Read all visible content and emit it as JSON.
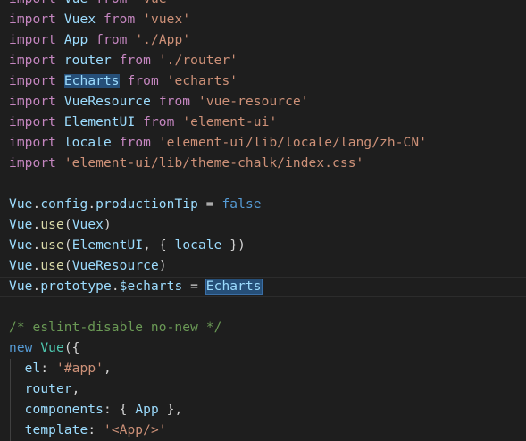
{
  "editor": {
    "lines": [
      {
        "tokens": [
          {
            "t": "import",
            "c": "kw"
          },
          {
            "t": " ",
            "c": "punc"
          },
          {
            "t": "Vue",
            "c": "id"
          },
          {
            "t": " ",
            "c": "punc"
          },
          {
            "t": "from",
            "c": "kw"
          },
          {
            "t": " ",
            "c": "punc"
          },
          {
            "t": "'vue'",
            "c": "str"
          }
        ]
      },
      {
        "tokens": [
          {
            "t": "import",
            "c": "kw"
          },
          {
            "t": " ",
            "c": "punc"
          },
          {
            "t": "Vuex",
            "c": "id"
          },
          {
            "t": " ",
            "c": "punc"
          },
          {
            "t": "from",
            "c": "kw"
          },
          {
            "t": " ",
            "c": "punc"
          },
          {
            "t": "'vuex'",
            "c": "str"
          }
        ]
      },
      {
        "tokens": [
          {
            "t": "import",
            "c": "kw"
          },
          {
            "t": " ",
            "c": "punc"
          },
          {
            "t": "App",
            "c": "id"
          },
          {
            "t": " ",
            "c": "punc"
          },
          {
            "t": "from",
            "c": "kw"
          },
          {
            "t": " ",
            "c": "punc"
          },
          {
            "t": "'./App'",
            "c": "str"
          }
        ]
      },
      {
        "tokens": [
          {
            "t": "import",
            "c": "kw"
          },
          {
            "t": " ",
            "c": "punc"
          },
          {
            "t": "router",
            "c": "id"
          },
          {
            "t": " ",
            "c": "punc"
          },
          {
            "t": "from",
            "c": "kw"
          },
          {
            "t": " ",
            "c": "punc"
          },
          {
            "t": "'./router'",
            "c": "str"
          }
        ]
      },
      {
        "tokens": [
          {
            "t": "import",
            "c": "kw"
          },
          {
            "t": " ",
            "c": "punc"
          },
          {
            "t": "Echarts",
            "c": "id hl"
          },
          {
            "t": " ",
            "c": "punc"
          },
          {
            "t": "from",
            "c": "kw"
          },
          {
            "t": " ",
            "c": "punc"
          },
          {
            "t": "'echarts'",
            "c": "str"
          }
        ]
      },
      {
        "tokens": [
          {
            "t": "import",
            "c": "kw"
          },
          {
            "t": " ",
            "c": "punc"
          },
          {
            "t": "VueResource",
            "c": "id"
          },
          {
            "t": " ",
            "c": "punc"
          },
          {
            "t": "from",
            "c": "kw"
          },
          {
            "t": " ",
            "c": "punc"
          },
          {
            "t": "'vue-resource'",
            "c": "str"
          }
        ]
      },
      {
        "tokens": [
          {
            "t": "import",
            "c": "kw"
          },
          {
            "t": " ",
            "c": "punc"
          },
          {
            "t": "ElementUI",
            "c": "id"
          },
          {
            "t": " ",
            "c": "punc"
          },
          {
            "t": "from",
            "c": "kw"
          },
          {
            "t": " ",
            "c": "punc"
          },
          {
            "t": "'element-ui'",
            "c": "str"
          }
        ]
      },
      {
        "tokens": [
          {
            "t": "import",
            "c": "kw"
          },
          {
            "t": " ",
            "c": "punc"
          },
          {
            "t": "locale",
            "c": "id"
          },
          {
            "t": " ",
            "c": "punc"
          },
          {
            "t": "from",
            "c": "kw"
          },
          {
            "t": " ",
            "c": "punc"
          },
          {
            "t": "'element-ui/lib/locale/lang/zh-CN'",
            "c": "str"
          }
        ]
      },
      {
        "tokens": [
          {
            "t": "import",
            "c": "kw"
          },
          {
            "t": " ",
            "c": "punc"
          },
          {
            "t": "'element-ui/lib/theme-chalk/index.css'",
            "c": "str"
          }
        ]
      },
      {
        "tokens": []
      },
      {
        "tokens": [
          {
            "t": "Vue",
            "c": "id"
          },
          {
            "t": ".",
            "c": "punc"
          },
          {
            "t": "config",
            "c": "prop"
          },
          {
            "t": ".",
            "c": "punc"
          },
          {
            "t": "productionTip",
            "c": "prop"
          },
          {
            "t": " = ",
            "c": "op"
          },
          {
            "t": "false",
            "c": "kw2"
          }
        ]
      },
      {
        "tokens": [
          {
            "t": "Vue",
            "c": "id"
          },
          {
            "t": ".",
            "c": "punc"
          },
          {
            "t": "use",
            "c": "fn"
          },
          {
            "t": "(",
            "c": "punc"
          },
          {
            "t": "Vuex",
            "c": "id"
          },
          {
            "t": ")",
            "c": "punc"
          }
        ]
      },
      {
        "tokens": [
          {
            "t": "Vue",
            "c": "id"
          },
          {
            "t": ".",
            "c": "punc"
          },
          {
            "t": "use",
            "c": "fn"
          },
          {
            "t": "(",
            "c": "punc"
          },
          {
            "t": "ElementUI",
            "c": "id"
          },
          {
            "t": ", { ",
            "c": "punc"
          },
          {
            "t": "locale",
            "c": "id"
          },
          {
            "t": " })",
            "c": "punc"
          }
        ]
      },
      {
        "tokens": [
          {
            "t": "Vue",
            "c": "id"
          },
          {
            "t": ".",
            "c": "punc"
          },
          {
            "t": "use",
            "c": "fn"
          },
          {
            "t": "(",
            "c": "punc"
          },
          {
            "t": "VueResource",
            "c": "id"
          },
          {
            "t": ")",
            "c": "punc"
          }
        ]
      },
      {
        "current": true,
        "tokens": [
          {
            "t": "Vue",
            "c": "id"
          },
          {
            "t": ".",
            "c": "punc"
          },
          {
            "t": "prototype",
            "c": "prop"
          },
          {
            "t": ".",
            "c": "punc"
          },
          {
            "t": "$echarts",
            "c": "prop"
          },
          {
            "t": " = ",
            "c": "op"
          },
          {
            "t": "Echarts",
            "c": "id hl2"
          }
        ]
      },
      {
        "tokens": []
      },
      {
        "tokens": [
          {
            "t": "/* eslint-disable no-new */",
            "c": "cmt"
          }
        ]
      },
      {
        "tokens": [
          {
            "t": "new",
            "c": "kw2"
          },
          {
            "t": " ",
            "c": "punc"
          },
          {
            "t": "Vue",
            "c": "cls"
          },
          {
            "t": "({",
            "c": "punc"
          }
        ]
      },
      {
        "guide": true,
        "tokens": [
          {
            "t": "  ",
            "c": "punc"
          },
          {
            "t": "el",
            "c": "prop"
          },
          {
            "t": ": ",
            "c": "punc"
          },
          {
            "t": "'#app'",
            "c": "str"
          },
          {
            "t": ",",
            "c": "punc"
          }
        ]
      },
      {
        "guide": true,
        "tokens": [
          {
            "t": "  ",
            "c": "punc"
          },
          {
            "t": "router",
            "c": "id"
          },
          {
            "t": ",",
            "c": "punc"
          }
        ]
      },
      {
        "guide": true,
        "tokens": [
          {
            "t": "  ",
            "c": "punc"
          },
          {
            "t": "components",
            "c": "prop"
          },
          {
            "t": ": { ",
            "c": "punc"
          },
          {
            "t": "App",
            "c": "id"
          },
          {
            "t": " },",
            "c": "punc"
          }
        ]
      },
      {
        "guide": true,
        "tokens": [
          {
            "t": "  ",
            "c": "punc"
          },
          {
            "t": "template",
            "c": "prop"
          },
          {
            "t": ": ",
            "c": "punc"
          },
          {
            "t": "'<App/>'",
            "c": "str"
          }
        ]
      }
    ]
  }
}
